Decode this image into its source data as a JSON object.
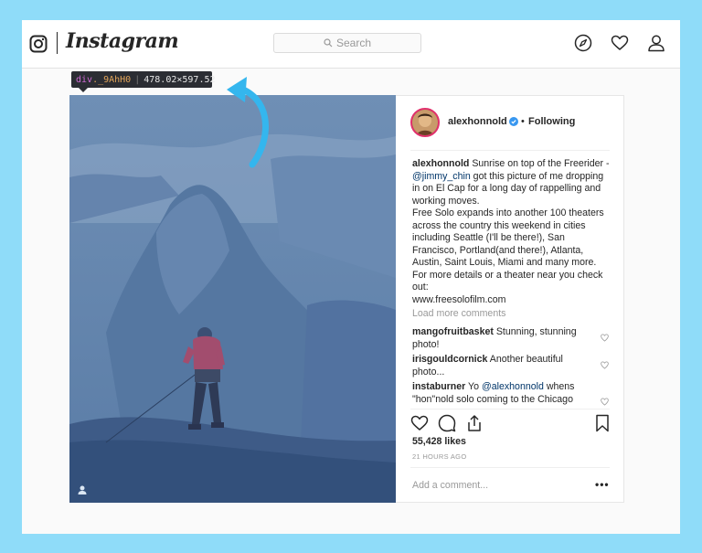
{
  "header": {
    "logo_text": "Instagram",
    "search_placeholder": "Search"
  },
  "devtools_tooltip": {
    "tag": "div",
    "class_name": "._9AhH0",
    "dimensions": "478.02×597.52"
  },
  "post": {
    "username": "alexhonnold",
    "follow_dot": "•",
    "follow_status": "Following",
    "caption": {
      "author": "alexhonnold",
      "text_1": " Sunrise on top of the Freerider - ",
      "mention": "@jimmy_chin",
      "text_2": " got this picture of me dropping in on El Cap for a long day of rappelling and working moves.",
      "text_3": "Free Solo expands into another 100 theaters across the country this weekend in cities including Seattle (I'll be there!), San Francisco, Portland(and there!), Atlanta, Austin, Saint Louis, Miami and many more. For more details or a theater near you check out:",
      "link": "www.freesolofilm.com"
    },
    "load_more": "Load more comments",
    "comments": [
      {
        "user": "mangofruitbasket",
        "text": " Stunning, stunning photo!"
      },
      {
        "user": "irisgouldcornick",
        "text": " Another beautiful photo..."
      },
      {
        "user": "instaburner",
        "text_pre": " Yo ",
        "mention": "@alexhonnold",
        "text_post": " whens \"hon\"nold solo coming to the Chicago"
      }
    ],
    "likes": "55,428 likes",
    "timestamp": "21 HOURS AGO",
    "add_comment_placeholder": "Add a comment...",
    "more_options": "•••"
  },
  "colors": {
    "background": "#8fdcf9",
    "photo_overlay": "#5e82aa",
    "tooltip_bg": "#2b2d33",
    "arrow": "#34b6ee",
    "mention": "#003569"
  }
}
